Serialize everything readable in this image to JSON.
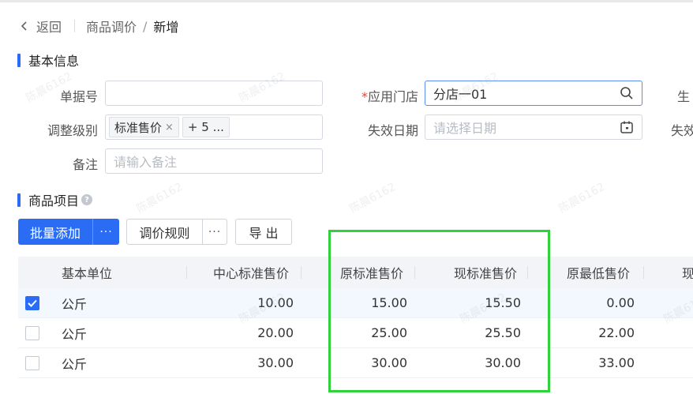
{
  "breadcrumb": {
    "back": "返回",
    "parent": "商品调价",
    "separator": "/",
    "current": "新增"
  },
  "sections": {
    "basic_info": "基本信息",
    "items": "商品项目"
  },
  "form": {
    "doc_no": {
      "label": "单据号",
      "value": ""
    },
    "store": {
      "required_mark": "*",
      "label": "应用门店",
      "value": "分店一01"
    },
    "right_col_label_1": "生",
    "adjust_level": {
      "label": "调整级别",
      "tag": "标准售价",
      "tag_close": "×",
      "more_tag": "+ 5 ..."
    },
    "expire_date": {
      "label": "失效日期",
      "placeholder": "请选择日期"
    },
    "right_col_label_2": "失效",
    "remark": {
      "label": "备注",
      "placeholder": "请输入备注"
    }
  },
  "toolbar": {
    "batch_add": "批量添加",
    "more_dots": "···",
    "price_rule": "调价规则",
    "more_dots_2": "···",
    "export": "导 出"
  },
  "table": {
    "columns": [
      "基本单位",
      "中心标准售价",
      "原标准售价",
      "现标准售价",
      "原最低售价",
      "现"
    ],
    "rows": [
      {
        "checked": true,
        "unit": "公斤",
        "center_price": "10.00",
        "orig_price": "15.00",
        "new_price": "15.50",
        "orig_min": "0.00"
      },
      {
        "checked": false,
        "unit": "公斤",
        "center_price": "20.00",
        "orig_price": "25.00",
        "new_price": "25.50",
        "orig_min": "22.00"
      },
      {
        "checked": false,
        "unit": "公斤",
        "center_price": "30.00",
        "orig_price": "30.00",
        "new_price": "30.00",
        "orig_min": "33.00"
      }
    ]
  },
  "watermark_text": "陈晨6162",
  "colors": {
    "primary": "#2a6df4",
    "highlight": "#2fd23a",
    "required": "#f04134"
  }
}
